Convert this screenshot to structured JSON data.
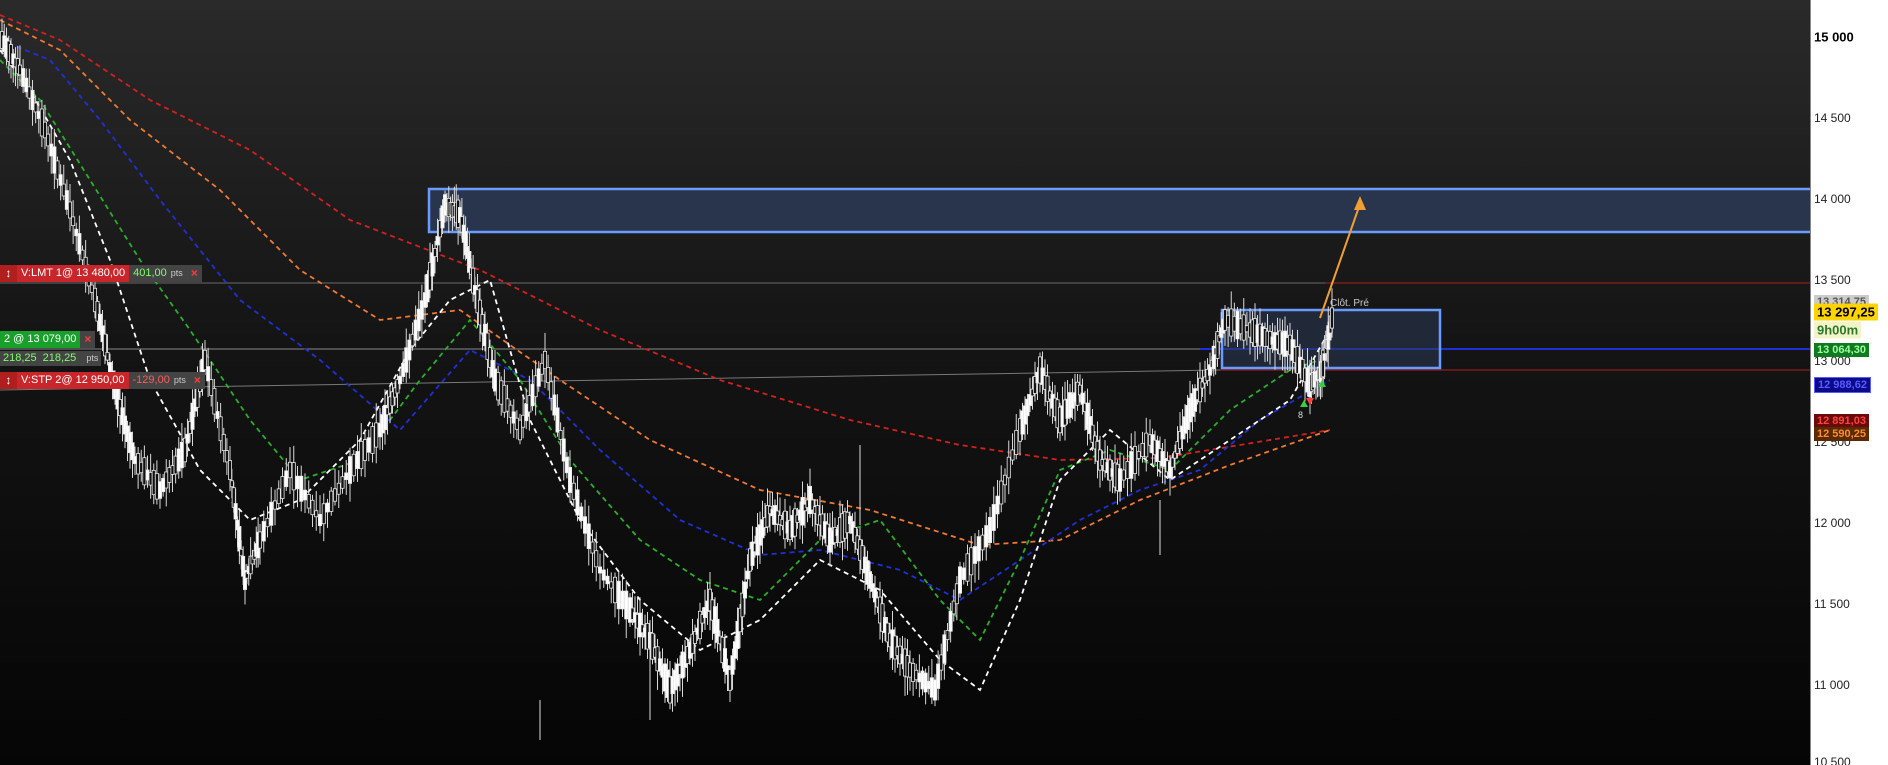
{
  "price_axis": {
    "ticks": [
      "15 000",
      "14 500",
      "14 000",
      "13 500",
      "13 000",
      "12 500",
      "12 000",
      "11 500",
      "11 000",
      "10 500"
    ],
    "last_price": "13 297,25",
    "prior_high_tag": "13 314,75",
    "timer": "9h00m",
    "green_level": "13 064,30",
    "blue_level": "12 988,62",
    "red_level": "12 891,03",
    "orange_level": "12 590,25"
  },
  "orders": {
    "limit": {
      "label": "V:LMT 1@ 13 480,00",
      "pnl": "401,00",
      "pts": "pts",
      "close": "×"
    },
    "position": {
      "label": "2 @ 13 079,00",
      "close": "×",
      "pnl_a": "218,25",
      "pnl_b": "218,25",
      "pts": "pts"
    },
    "stop": {
      "label": "V:STP 2@ 12 950,00",
      "pnl": "-129,00",
      "pts": "pts",
      "close": "×"
    },
    "drag_icon": "↕"
  },
  "zones": {
    "label": "Clôt. Pré"
  },
  "signals": {
    "count": "8"
  },
  "colors": {
    "zone_border": "#6a9cff",
    "zone_fill": "#2c3a55",
    "arrow": "#f0a030",
    "ma_red": "#d42020",
    "ma_orange": "#f07a30",
    "ma_blue": "#2030d8",
    "ma_green": "#28b028",
    "ma_white": "#ffffff"
  }
}
